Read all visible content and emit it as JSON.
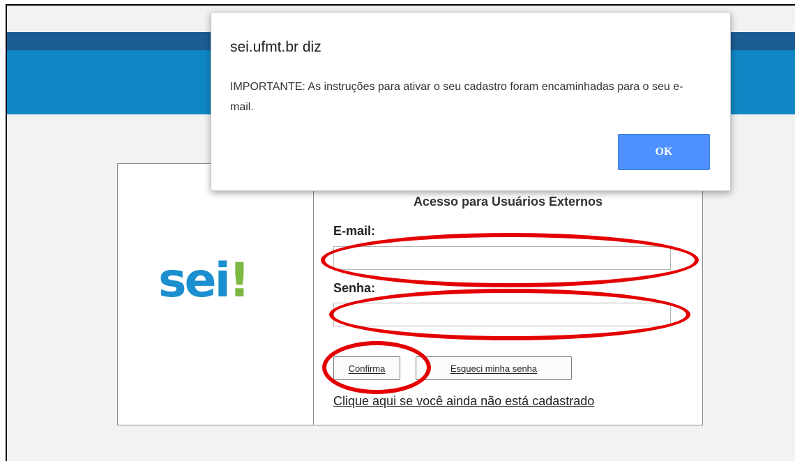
{
  "header": {
    "bar_dark_color": "#1c5c94",
    "bar_light_color": "#0f87c4"
  },
  "logo": {
    "text_main": "sei",
    "text_accent": "!",
    "main_color": "#1b8fcf",
    "accent_color": "#7db842"
  },
  "login": {
    "title": "Acesso para Usuários Externos",
    "email_label": "E-mail:",
    "email_value": "",
    "password_label": "Senha:",
    "password_value": "",
    "confirm_label": "Confirma",
    "forgot_label": "Esqueci minha senha",
    "register_link": "Clique aqui se você ainda não está cadastrado"
  },
  "dialog": {
    "title": "sei.ufmt.br diz",
    "message": "IMPORTANTE: As instruções para ativar o seu cadastro foram encaminhadas para o seu e-mail.",
    "ok_label": "OK",
    "ok_color": "#4d90fe"
  },
  "annotations": {
    "highlight_color": "#e40000"
  }
}
